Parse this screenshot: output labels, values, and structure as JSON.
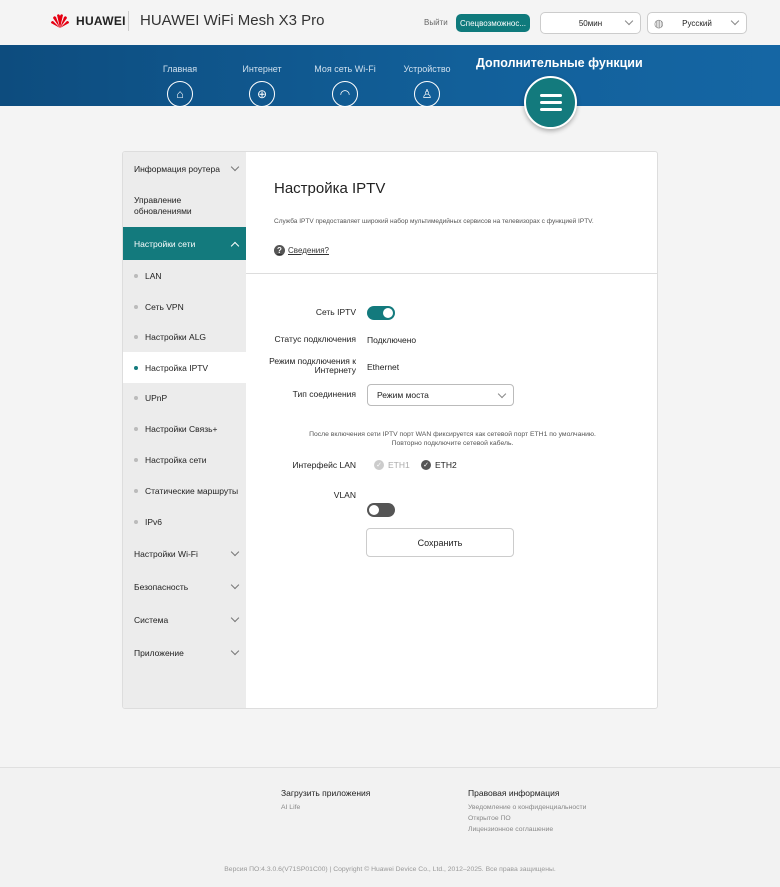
{
  "header": {
    "brand": "HUAWEI",
    "product": "HUAWEI WiFi Mesh X3 Pro",
    "logout": "Выйти",
    "accessibility": "Спецвозможнос...",
    "timeout": "50мин",
    "language": "Русский"
  },
  "nav": {
    "items": [
      {
        "label": "Главная",
        "icon": "home-icon"
      },
      {
        "label": "Интернет",
        "icon": "globe-icon"
      },
      {
        "label": "Моя сеть Wi-Fi",
        "icon": "wifi-icon"
      },
      {
        "label": "Устройство",
        "icon": "user-icon"
      }
    ],
    "active": "Дополнительные функции"
  },
  "sidebar": {
    "groups": [
      "Информация роутера",
      "Управление обновлениями",
      "Настройки сети",
      "Настройки Wi-Fi",
      "Безопасность",
      "Система",
      "Приложение"
    ],
    "sub": [
      "LAN",
      "Сеть VPN",
      "Настройки ALG",
      "Настройка IPTV",
      "UPnP",
      "Настройки Связь+",
      "Настройка сети",
      "Статические маршруты",
      "IPv6"
    ]
  },
  "main": {
    "title": "Настройка IPTV",
    "description": "Служба IPTV предоставляет широкий набор мультимедийных сервисов на телевизорах с функцией IPTV.",
    "help": "Сведения?",
    "form": {
      "iptv_label": "Сеть IPTV",
      "iptv_on": true,
      "status_label": "Статус подключения",
      "status_value": "Подключено",
      "mode_label": "Режим подключения к Интернету",
      "mode_value": "Ethernet",
      "type_label": "Тип соединения",
      "type_value": "Режим моста",
      "note_line1": "После включения сети IPTV порт WAN фиксируется как сетевой порт ETH1 по умолчанию.",
      "note_line2": "Повторно подключите сетевой кабель.",
      "lan_label": "Интерфейс LAN",
      "eth1": "ETH1",
      "eth1_checked": true,
      "eth1_disabled": true,
      "eth2": "ETH2",
      "eth2_checked": true,
      "vlan_label": "VLAN",
      "vlan_on": false,
      "save": "Сохранить"
    }
  },
  "footer": {
    "apps_title": "Загрузить приложения",
    "apps": [
      "AI Life"
    ],
    "legal_title": "Правовая информация",
    "legal": [
      "Уведомление о конфиденциальности",
      "Открытое ПО",
      "Лицензионное соглашение"
    ],
    "copyright": "Версия ПО:4.3.0.6(V71SP01C00) | Copyright © Huawei Device Co., Ltd., 2012–2025. Все права защищены."
  },
  "colors": {
    "accent": "#137a7d",
    "banner": "#12609a"
  }
}
